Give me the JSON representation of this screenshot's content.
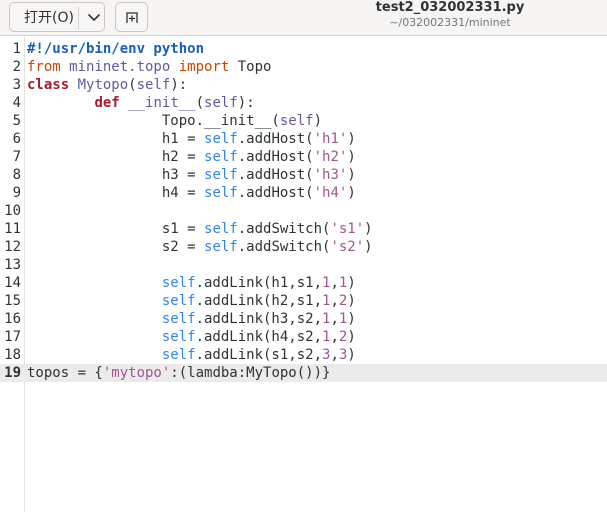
{
  "header": {
    "open_label": "打开(O)",
    "title": "test2_032002331.py",
    "path": "~/032002331/mininet"
  },
  "editor": {
    "current_line": 19,
    "lines": [
      {
        "n": "1",
        "tokens": [
          {
            "t": "#!/usr/bin/env python",
            "c": "sheb"
          }
        ]
      },
      {
        "n": "2",
        "tokens": [
          {
            "t": "from",
            "c": "kw-orange"
          },
          {
            "t": " mininet.topo ",
            "c": "cls"
          },
          {
            "t": "import",
            "c": "kw-orange"
          },
          {
            "t": " Topo",
            "c": ""
          }
        ]
      },
      {
        "n": "3",
        "tokens": [
          {
            "t": "class",
            "c": "kw"
          },
          {
            "t": " ",
            "c": ""
          },
          {
            "t": "Mytopo",
            "c": "cls"
          },
          {
            "t": "(",
            "c": ""
          },
          {
            "t": "self",
            "c": "cls"
          },
          {
            "t": "):",
            "c": ""
          }
        ]
      },
      {
        "n": "4",
        "tokens": [
          {
            "t": "        ",
            "c": ""
          },
          {
            "t": "def",
            "c": "kw"
          },
          {
            "t": " ",
            "c": ""
          },
          {
            "t": "__init__",
            "c": "cls"
          },
          {
            "t": "(",
            "c": ""
          },
          {
            "t": "self",
            "c": "cls"
          },
          {
            "t": "):",
            "c": ""
          }
        ]
      },
      {
        "n": "5",
        "tokens": [
          {
            "t": "                Topo.__init__(",
            "c": ""
          },
          {
            "t": "self",
            "c": "cls"
          },
          {
            "t": ")",
            "c": ""
          }
        ]
      },
      {
        "n": "6",
        "tokens": [
          {
            "t": "                h1 = ",
            "c": ""
          },
          {
            "t": "self",
            "c": "selfc"
          },
          {
            "t": ".addHost(",
            "c": ""
          },
          {
            "t": "'h1'",
            "c": "str"
          },
          {
            "t": ")",
            "c": ""
          }
        ]
      },
      {
        "n": "7",
        "tokens": [
          {
            "t": "                h2 = ",
            "c": ""
          },
          {
            "t": "self",
            "c": "selfc"
          },
          {
            "t": ".addHost(",
            "c": ""
          },
          {
            "t": "'h2'",
            "c": "str"
          },
          {
            "t": ")",
            "c": ""
          }
        ]
      },
      {
        "n": "8",
        "tokens": [
          {
            "t": "                h3 = ",
            "c": ""
          },
          {
            "t": "self",
            "c": "selfc"
          },
          {
            "t": ".addHost(",
            "c": ""
          },
          {
            "t": "'h3'",
            "c": "str"
          },
          {
            "t": ")",
            "c": ""
          }
        ]
      },
      {
        "n": "9",
        "tokens": [
          {
            "t": "                h4 = ",
            "c": ""
          },
          {
            "t": "self",
            "c": "selfc"
          },
          {
            "t": ".addHost(",
            "c": ""
          },
          {
            "t": "'h4'",
            "c": "str"
          },
          {
            "t": ")",
            "c": ""
          }
        ]
      },
      {
        "n": "10",
        "tokens": []
      },
      {
        "n": "11",
        "tokens": [
          {
            "t": "                s1 = ",
            "c": ""
          },
          {
            "t": "self",
            "c": "selfc"
          },
          {
            "t": ".addSwitch(",
            "c": ""
          },
          {
            "t": "'s1'",
            "c": "str"
          },
          {
            "t": ")",
            "c": ""
          }
        ]
      },
      {
        "n": "12",
        "tokens": [
          {
            "t": "                s2 = ",
            "c": ""
          },
          {
            "t": "self",
            "c": "selfc"
          },
          {
            "t": ".addSwitch(",
            "c": ""
          },
          {
            "t": "'s2'",
            "c": "str"
          },
          {
            "t": ")",
            "c": ""
          }
        ]
      },
      {
        "n": "13",
        "tokens": []
      },
      {
        "n": "14",
        "tokens": [
          {
            "t": "                ",
            "c": ""
          },
          {
            "t": "self",
            "c": "selfc"
          },
          {
            "t": ".addLink(h1,s1,",
            "c": ""
          },
          {
            "t": "1",
            "c": "num"
          },
          {
            "t": ",",
            "c": ""
          },
          {
            "t": "1",
            "c": "num"
          },
          {
            "t": ")",
            "c": ""
          }
        ]
      },
      {
        "n": "15",
        "tokens": [
          {
            "t": "                ",
            "c": ""
          },
          {
            "t": "self",
            "c": "selfc"
          },
          {
            "t": ".addLink(h2,s1,",
            "c": ""
          },
          {
            "t": "1",
            "c": "num"
          },
          {
            "t": ",",
            "c": ""
          },
          {
            "t": "2",
            "c": "num"
          },
          {
            "t": ")",
            "c": ""
          }
        ]
      },
      {
        "n": "16",
        "tokens": [
          {
            "t": "                ",
            "c": ""
          },
          {
            "t": "self",
            "c": "selfc"
          },
          {
            "t": ".addLink(h3,s2,",
            "c": ""
          },
          {
            "t": "1",
            "c": "num"
          },
          {
            "t": ",",
            "c": ""
          },
          {
            "t": "1",
            "c": "num"
          },
          {
            "t": ")",
            "c": ""
          }
        ]
      },
      {
        "n": "17",
        "tokens": [
          {
            "t": "                ",
            "c": ""
          },
          {
            "t": "self",
            "c": "selfc"
          },
          {
            "t": ".addLink(h4,s2,",
            "c": ""
          },
          {
            "t": "1",
            "c": "num"
          },
          {
            "t": ",",
            "c": ""
          },
          {
            "t": "2",
            "c": "num"
          },
          {
            "t": ")",
            "c": ""
          }
        ]
      },
      {
        "n": "18",
        "tokens": [
          {
            "t": "                ",
            "c": ""
          },
          {
            "t": "self",
            "c": "selfc"
          },
          {
            "t": ".addLink(s1,s2,",
            "c": ""
          },
          {
            "t": "3",
            "c": "num"
          },
          {
            "t": ",",
            "c": ""
          },
          {
            "t": "3",
            "c": "num"
          },
          {
            "t": ")",
            "c": ""
          }
        ]
      },
      {
        "n": "19",
        "tokens": [
          {
            "t": "topos = {",
            "c": ""
          },
          {
            "t": "'mytopo'",
            "c": "str"
          },
          {
            "t": ":(lamdba:MyTopo())}",
            "c": ""
          }
        ]
      }
    ]
  },
  "icons": {
    "open_dropdown": "chevron-down-icon",
    "new_tab": "new-document-icon"
  }
}
